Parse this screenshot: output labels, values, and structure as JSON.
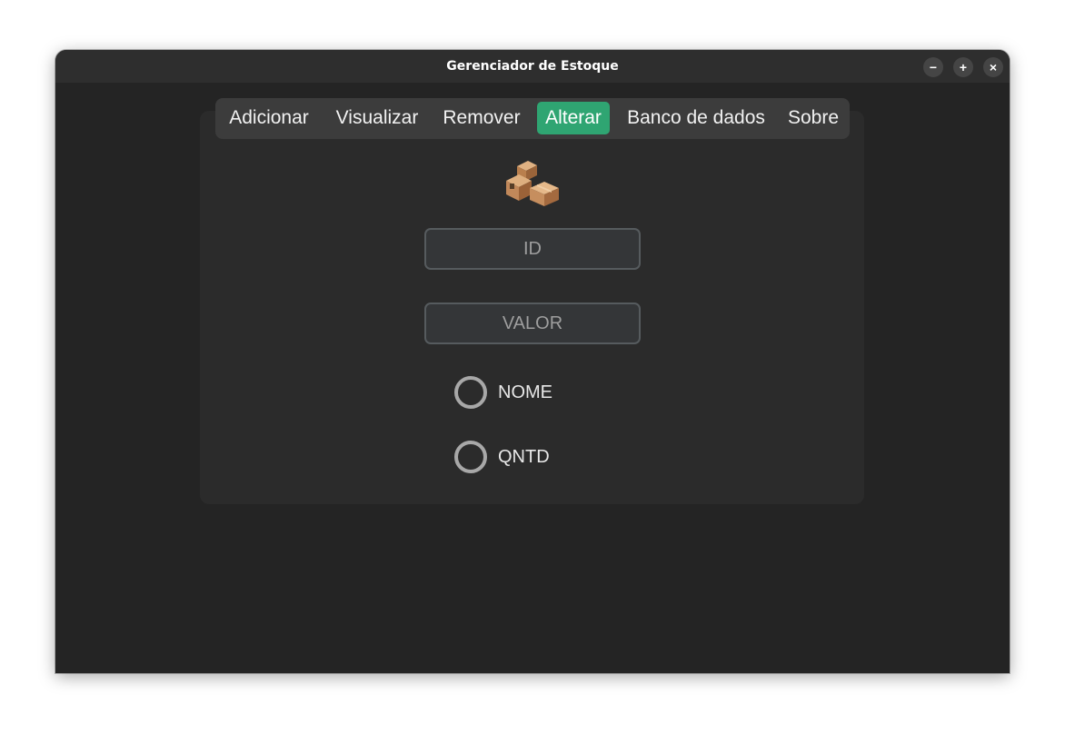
{
  "window": {
    "title": "Gerenciador de Estoque",
    "controls": {
      "minimize": "−",
      "maximize": "+",
      "close": "×"
    }
  },
  "tabs": [
    {
      "label": "Adicionar",
      "active": false
    },
    {
      "label": "Visualizar",
      "active": false
    },
    {
      "label": "Remover",
      "active": false
    },
    {
      "label": "Alterar",
      "active": true
    },
    {
      "label": "Banco de dados",
      "active": false
    },
    {
      "label": "Sobre",
      "active": false
    }
  ],
  "form": {
    "icon": "package-boxes-icon",
    "id_field": {
      "placeholder": "ID",
      "value": ""
    },
    "valor_field": {
      "placeholder": "VALOR",
      "value": ""
    },
    "radios": [
      {
        "label": "NOME",
        "selected": false
      },
      {
        "label": "QNTD",
        "selected": false
      }
    ]
  },
  "colors": {
    "accent": "#2fa572",
    "window_bg": "#242424",
    "titlebar_bg": "#2e2e2e",
    "card_bg": "#2b2b2b",
    "tabbar_bg": "#3c3c3c"
  }
}
